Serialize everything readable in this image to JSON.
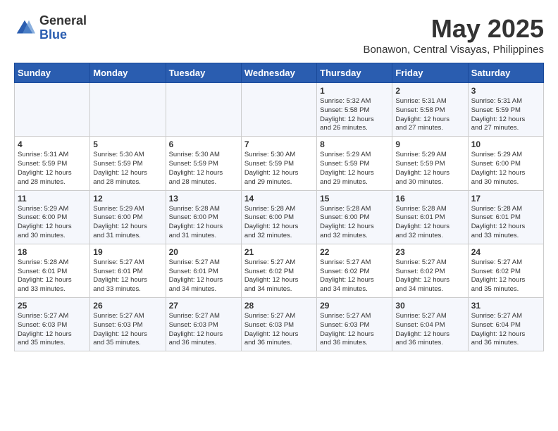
{
  "logo": {
    "general": "General",
    "blue": "Blue"
  },
  "title": "May 2025",
  "subtitle": "Bonawon, Central Visayas, Philippines",
  "days": [
    "Sunday",
    "Monday",
    "Tuesday",
    "Wednesday",
    "Thursday",
    "Friday",
    "Saturday"
  ],
  "weeks": [
    [
      {
        "day": "",
        "info": ""
      },
      {
        "day": "",
        "info": ""
      },
      {
        "day": "",
        "info": ""
      },
      {
        "day": "",
        "info": ""
      },
      {
        "day": "1",
        "info": "Sunrise: 5:32 AM\nSunset: 5:58 PM\nDaylight: 12 hours\nand 26 minutes."
      },
      {
        "day": "2",
        "info": "Sunrise: 5:31 AM\nSunset: 5:58 PM\nDaylight: 12 hours\nand 27 minutes."
      },
      {
        "day": "3",
        "info": "Sunrise: 5:31 AM\nSunset: 5:59 PM\nDaylight: 12 hours\nand 27 minutes."
      }
    ],
    [
      {
        "day": "4",
        "info": "Sunrise: 5:31 AM\nSunset: 5:59 PM\nDaylight: 12 hours\nand 28 minutes."
      },
      {
        "day": "5",
        "info": "Sunrise: 5:30 AM\nSunset: 5:59 PM\nDaylight: 12 hours\nand 28 minutes."
      },
      {
        "day": "6",
        "info": "Sunrise: 5:30 AM\nSunset: 5:59 PM\nDaylight: 12 hours\nand 28 minutes."
      },
      {
        "day": "7",
        "info": "Sunrise: 5:30 AM\nSunset: 5:59 PM\nDaylight: 12 hours\nand 29 minutes."
      },
      {
        "day": "8",
        "info": "Sunrise: 5:29 AM\nSunset: 5:59 PM\nDaylight: 12 hours\nand 29 minutes."
      },
      {
        "day": "9",
        "info": "Sunrise: 5:29 AM\nSunset: 5:59 PM\nDaylight: 12 hours\nand 30 minutes."
      },
      {
        "day": "10",
        "info": "Sunrise: 5:29 AM\nSunset: 6:00 PM\nDaylight: 12 hours\nand 30 minutes."
      }
    ],
    [
      {
        "day": "11",
        "info": "Sunrise: 5:29 AM\nSunset: 6:00 PM\nDaylight: 12 hours\nand 30 minutes."
      },
      {
        "day": "12",
        "info": "Sunrise: 5:29 AM\nSunset: 6:00 PM\nDaylight: 12 hours\nand 31 minutes."
      },
      {
        "day": "13",
        "info": "Sunrise: 5:28 AM\nSunset: 6:00 PM\nDaylight: 12 hours\nand 31 minutes."
      },
      {
        "day": "14",
        "info": "Sunrise: 5:28 AM\nSunset: 6:00 PM\nDaylight: 12 hours\nand 32 minutes."
      },
      {
        "day": "15",
        "info": "Sunrise: 5:28 AM\nSunset: 6:00 PM\nDaylight: 12 hours\nand 32 minutes."
      },
      {
        "day": "16",
        "info": "Sunrise: 5:28 AM\nSunset: 6:01 PM\nDaylight: 12 hours\nand 32 minutes."
      },
      {
        "day": "17",
        "info": "Sunrise: 5:28 AM\nSunset: 6:01 PM\nDaylight: 12 hours\nand 33 minutes."
      }
    ],
    [
      {
        "day": "18",
        "info": "Sunrise: 5:28 AM\nSunset: 6:01 PM\nDaylight: 12 hours\nand 33 minutes."
      },
      {
        "day": "19",
        "info": "Sunrise: 5:27 AM\nSunset: 6:01 PM\nDaylight: 12 hours\nand 33 minutes."
      },
      {
        "day": "20",
        "info": "Sunrise: 5:27 AM\nSunset: 6:01 PM\nDaylight: 12 hours\nand 34 minutes."
      },
      {
        "day": "21",
        "info": "Sunrise: 5:27 AM\nSunset: 6:02 PM\nDaylight: 12 hours\nand 34 minutes."
      },
      {
        "day": "22",
        "info": "Sunrise: 5:27 AM\nSunset: 6:02 PM\nDaylight: 12 hours\nand 34 minutes."
      },
      {
        "day": "23",
        "info": "Sunrise: 5:27 AM\nSunset: 6:02 PM\nDaylight: 12 hours\nand 34 minutes."
      },
      {
        "day": "24",
        "info": "Sunrise: 5:27 AM\nSunset: 6:02 PM\nDaylight: 12 hours\nand 35 minutes."
      }
    ],
    [
      {
        "day": "25",
        "info": "Sunrise: 5:27 AM\nSunset: 6:03 PM\nDaylight: 12 hours\nand 35 minutes."
      },
      {
        "day": "26",
        "info": "Sunrise: 5:27 AM\nSunset: 6:03 PM\nDaylight: 12 hours\nand 35 minutes."
      },
      {
        "day": "27",
        "info": "Sunrise: 5:27 AM\nSunset: 6:03 PM\nDaylight: 12 hours\nand 36 minutes."
      },
      {
        "day": "28",
        "info": "Sunrise: 5:27 AM\nSunset: 6:03 PM\nDaylight: 12 hours\nand 36 minutes."
      },
      {
        "day": "29",
        "info": "Sunrise: 5:27 AM\nSunset: 6:03 PM\nDaylight: 12 hours\nand 36 minutes."
      },
      {
        "day": "30",
        "info": "Sunrise: 5:27 AM\nSunset: 6:04 PM\nDaylight: 12 hours\nand 36 minutes."
      },
      {
        "day": "31",
        "info": "Sunrise: 5:27 AM\nSunset: 6:04 PM\nDaylight: 12 hours\nand 36 minutes."
      }
    ]
  ]
}
